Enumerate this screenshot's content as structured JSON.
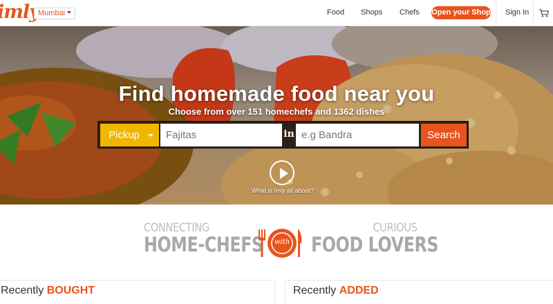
{
  "nav": {
    "logo": "imly",
    "city": "Mumbai",
    "links": [
      "Food",
      "Shops",
      "Chefs"
    ],
    "open_shop": "Open your Shop",
    "sign_in": "Sign In",
    "cart_icon": "cart-icon"
  },
  "hero": {
    "title": "Find homemade food near you",
    "subtitle": "Choose from over 151 homechefs and 1362 dishes",
    "mode": "Pickup",
    "food_placeholder": "Fajitas",
    "in_label": "in",
    "location_placeholder": "e.g Bandra",
    "search_label": "Search",
    "video_link": "What is imly all about?"
  },
  "connect": {
    "left_small": "CONNECTING",
    "left_big": "HOME-CHEFS",
    "plate_text": "with",
    "right_small": "CURIOUS",
    "right_big": "FOOD LOVERS"
  },
  "recent": [
    {
      "prefix": "Recently",
      "highlight": "BOUGHT"
    },
    {
      "prefix": "Recently",
      "highlight": "ADDED"
    }
  ],
  "colors": {
    "brand_orange": "#e8541e",
    "pickup_yellow": "#f0b600",
    "banner_gray": "#a8a8a8"
  }
}
